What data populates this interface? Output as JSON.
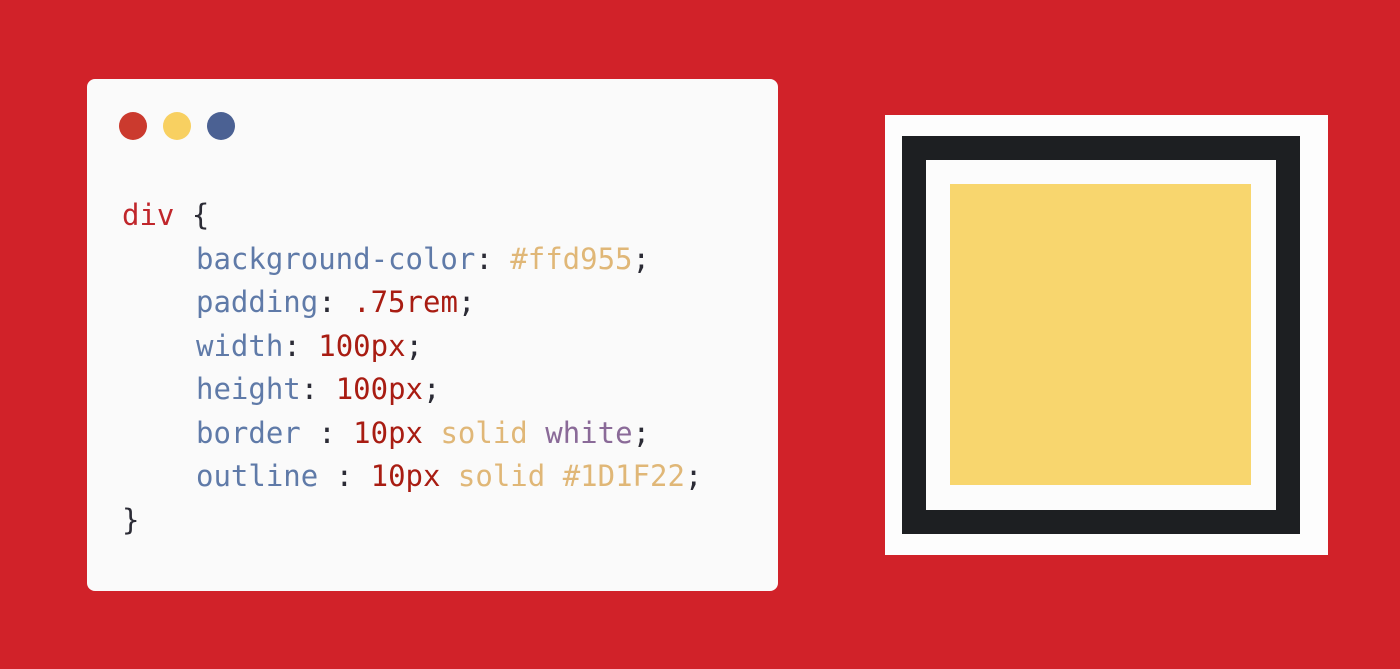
{
  "window_dots": [
    {
      "name": "red-dot",
      "color": "#cb3a2e"
    },
    {
      "name": "yellow-dot",
      "color": "#f8d061"
    },
    {
      "name": "blue-dot",
      "color": "#4b6193"
    }
  ],
  "code": {
    "selector": "div",
    "open_brace": "{",
    "close_brace": "}",
    "declarations": [
      {
        "property": "background-color",
        "colon": ": ",
        "values": [
          {
            "text": "#ffd955",
            "kind": "color"
          }
        ],
        "semicolon": ";"
      },
      {
        "property": "padding",
        "colon": ": ",
        "values": [
          {
            "text": ".75rem",
            "kind": "num"
          }
        ],
        "semicolon": ";"
      },
      {
        "property": "width",
        "colon": ": ",
        "values": [
          {
            "text": "100px",
            "kind": "num"
          }
        ],
        "semicolon": ";"
      },
      {
        "property": "height",
        "colon": ": ",
        "values": [
          {
            "text": "100px",
            "kind": "num"
          }
        ],
        "semicolon": ";"
      },
      {
        "property": "border",
        "colon": " : ",
        "values": [
          {
            "text": "10px",
            "kind": "num"
          },
          {
            "text": "solid",
            "kind": "keyword"
          },
          {
            "text": "white",
            "kind": "named"
          }
        ],
        "semicolon": ";"
      },
      {
        "property": "outline",
        "colon": " : ",
        "values": [
          {
            "text": "10px",
            "kind": "num"
          },
          {
            "text": "solid",
            "kind": "keyword"
          },
          {
            "text": "#1D1F22",
            "kind": "color"
          }
        ],
        "semicolon": ";"
      }
    ]
  },
  "preview": {
    "fill_color": "#ffd955",
    "border_color": "white",
    "outline_color": "#1D1F22"
  }
}
